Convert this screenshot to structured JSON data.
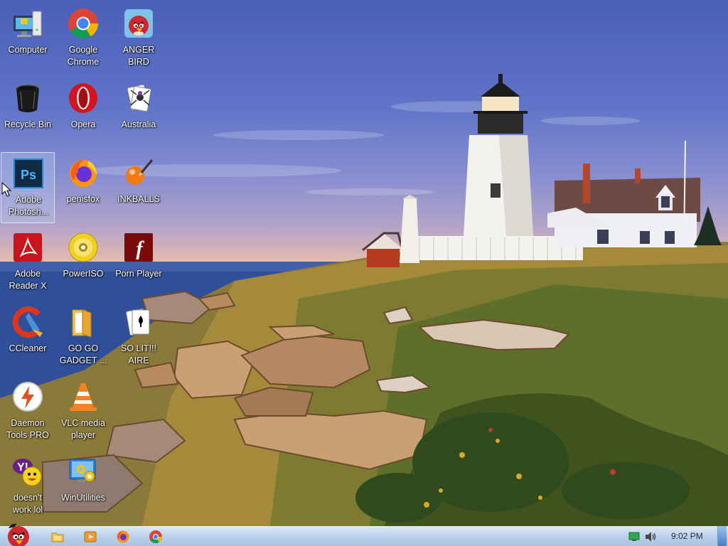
{
  "desktop": {
    "icons": [
      {
        "label": "Computer",
        "icon": "computer-icon"
      },
      {
        "label": "Google\nChrome",
        "icon": "chrome-icon"
      },
      {
        "label": "ANGER\nBIRD",
        "icon": "angry-bird-icon"
      },
      {
        "label": "Recycle Bin",
        "icon": "recycle-bin-icon"
      },
      {
        "label": "Opera",
        "icon": "opera-icon"
      },
      {
        "label": "Australia",
        "icon": "spider-solitaire-icon"
      },
      {
        "label": "Adobe\nPhotosh...",
        "icon": "photoshop-icon",
        "selected": true
      },
      {
        "label": "penisfox",
        "icon": "firefox-icon"
      },
      {
        "label": "INKBALLS",
        "icon": "inkball-icon"
      },
      {
        "label": "Adobe\nReader X",
        "icon": "adobe-reader-icon"
      },
      {
        "label": "PowerISO",
        "icon": "poweriso-icon"
      },
      {
        "label": "Porn Player",
        "icon": "flash-player-icon"
      },
      {
        "label": "CCleaner",
        "icon": "ccleaner-icon"
      },
      {
        "label": "GO GO\nGADGET ...",
        "icon": "folder-icon"
      },
      {
        "label": "SO LIT!!!\nAIRE",
        "icon": "solitaire-icon"
      },
      {
        "label": "Daemon\nTools PRO",
        "icon": "daemon-tools-icon"
      },
      {
        "label": "VLC media\nplayer",
        "icon": "vlc-icon"
      },
      {
        "label": "doesn't\nwork lol",
        "icon": "yahoo-messenger-icon"
      },
      {
        "label": "WinUtilities",
        "icon": "winutilities-icon"
      }
    ]
  },
  "taskbar": {
    "start_icon": "angry-bird-start-icon",
    "pinned": [
      {
        "icon": "explorer-icon"
      },
      {
        "icon": "media-player-icon"
      },
      {
        "icon": "firefox-icon"
      },
      {
        "icon": "chrome-icon"
      }
    ],
    "tray": {
      "network_icon": "network-icon",
      "volume_icon": "volume-icon"
    },
    "clock": "9:02 PM"
  }
}
